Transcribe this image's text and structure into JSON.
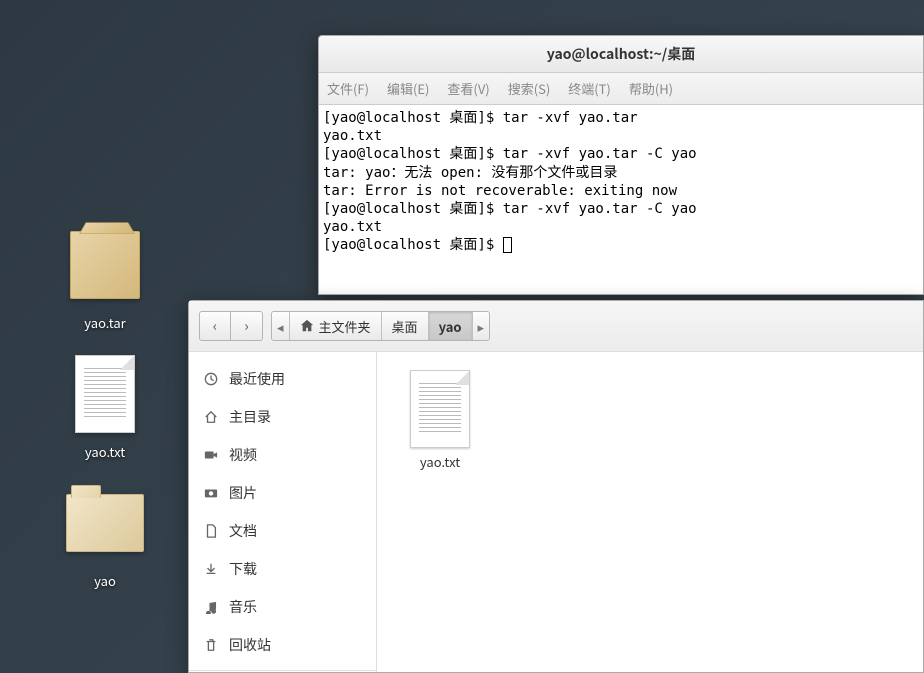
{
  "desktop": {
    "icons": [
      {
        "name": "yao.tar",
        "type": "archive"
      },
      {
        "name": "yao.txt",
        "type": "textfile"
      },
      {
        "name": "yao",
        "type": "folder"
      }
    ]
  },
  "terminal": {
    "title": "yao@localhost:~/桌面",
    "menu": {
      "file": "文件(F)",
      "edit": "编辑(E)",
      "view": "查看(V)",
      "search": "搜索(S)",
      "term": "终端(T)",
      "help": "帮助(H)"
    },
    "lines": [
      "[yao@localhost 桌面]$ tar -xvf yao.tar",
      "yao.txt",
      "[yao@localhost 桌面]$ tar -xvf yao.tar -C yao",
      "tar: yao：无法 open: 没有那个文件或目录",
      "tar: Error is not recoverable: exiting now",
      "[yao@localhost 桌面]$ tar -xvf yao.tar -C yao",
      "yao.txt",
      "[yao@localhost 桌面]$ "
    ]
  },
  "filemgr": {
    "path": {
      "home": "主文件夹",
      "seg1": "桌面",
      "seg2": "yao"
    },
    "sidebar": {
      "recent": "最近使用",
      "home": "主目录",
      "videos": "视频",
      "pictures": "图片",
      "documents": "文档",
      "downloads": "下载",
      "music": "音乐",
      "trash": "回收站"
    },
    "files": [
      {
        "name": "yao.txt",
        "type": "textfile"
      }
    ]
  }
}
